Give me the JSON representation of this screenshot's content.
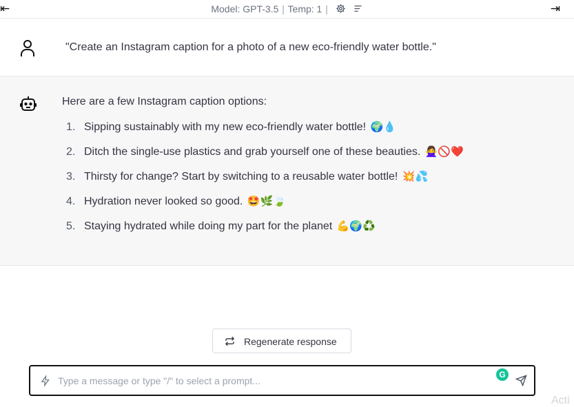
{
  "header": {
    "model_label": "Model: GPT-3.5",
    "temp_label": "Temp: 1",
    "separator": "|",
    "left_collapse_glyph": "⇤",
    "right_expand_glyph": "⇥"
  },
  "conversation": {
    "user_message": "\"Create an Instagram caption for a photo of a new eco-friendly water bottle.\"",
    "assistant_intro": "Here are a few Instagram caption options:",
    "captions": [
      {
        "num": "1.",
        "text": "Sipping sustainably with my new eco-friendly water bottle!",
        "emoji": "🌍💧"
      },
      {
        "num": "2.",
        "text": "Ditch the single-use plastics and grab yourself one of these beauties.",
        "emoji": "🙅‍♀️🚫❤️"
      },
      {
        "num": "3.",
        "text": "Thirsty for change? Start by switching to a reusable water bottle!",
        "emoji": "💥💦"
      },
      {
        "num": "4.",
        "text": "Hydration never looked so good.",
        "emoji": "🤩🌿🍃"
      },
      {
        "num": "5.",
        "text": "Staying hydrated while doing my part for the planet",
        "emoji": "💪🌍♻️"
      }
    ]
  },
  "actions": {
    "regenerate_label": "Regenerate response"
  },
  "input": {
    "placeholder": "Type a message or type \"/\" to select a prompt...",
    "value": "",
    "grammarly_glyph": "G"
  },
  "watermark": "Acti",
  "icons": {
    "user": "user-icon",
    "bot": "bot-icon",
    "settings": "gear-icon",
    "menu": "menu-lines-icon",
    "regenerate": "repeat-icon",
    "bolt": "lightning-icon",
    "send": "send-icon"
  },
  "colors": {
    "assistant_bg": "#f7f7f8",
    "grammarly": "#15c39a",
    "border": "#e5e7eb"
  }
}
